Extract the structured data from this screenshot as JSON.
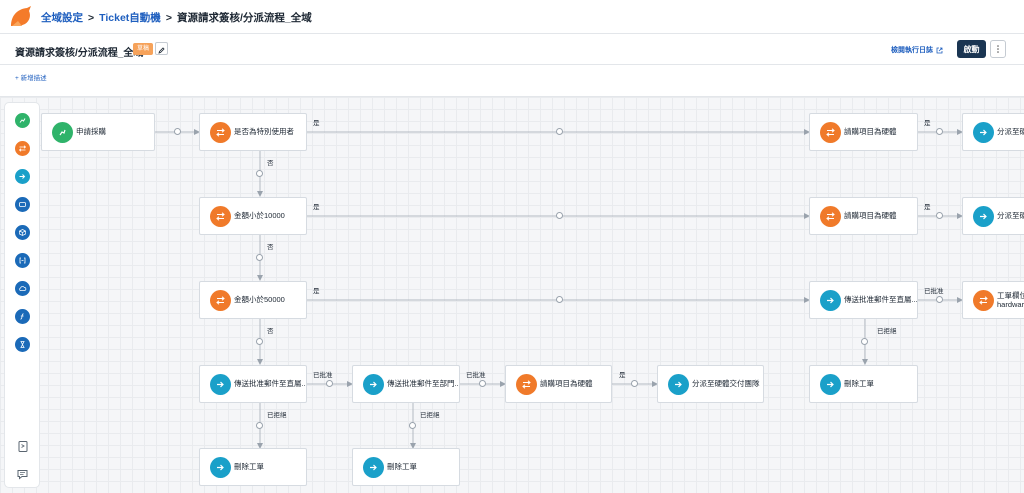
{
  "breadcrumb": {
    "items": [
      "全域設定",
      "Ticket自動機",
      "資源請求簽核/分派流程_全域"
    ],
    "separator": ">"
  },
  "header": {
    "title": "資源請求簽核/分派流程_全域",
    "status_badge": "草稿",
    "edit_icon": "pencil-icon",
    "log_link": "檢閱執行日誌",
    "log_icon": "external-link-icon",
    "start_button": "啟動",
    "more_icon": "vertical-dots-icon"
  },
  "add_description": "+ 新增描述",
  "colors": {
    "trigger": "#2fb36a",
    "condition": "#f07a2a",
    "action": "#1aa0c9",
    "toolblue": "#1b6ab8",
    "link": "#1f5fbf",
    "primary": "#1a3552"
  },
  "toolbox": {
    "items": [
      {
        "icon": "trigger-icon",
        "color": "#2fb36a"
      },
      {
        "icon": "condition-icon",
        "color": "#f07a2a"
      },
      {
        "icon": "action-arrow-icon",
        "color": "#1aa0c9"
      },
      {
        "icon": "ticket-icon",
        "color": "#1b6ab8"
      },
      {
        "icon": "cube-icon",
        "color": "#1b6ab8"
      },
      {
        "icon": "bracket-icon",
        "color": "#1b6ab8"
      },
      {
        "icon": "cloud-icon",
        "color": "#1b6ab8"
      },
      {
        "icon": "function-icon",
        "color": "#1b6ab8"
      },
      {
        "icon": "hourglass-icon",
        "color": "#1b6ab8"
      }
    ],
    "bottom": [
      "book-icon",
      "chat-icon"
    ]
  },
  "nodes": {
    "n_trigger": {
      "label": "申請採購",
      "type": "trigger"
    },
    "n_cond_special": {
      "label": "是否為特別使用者",
      "type": "condition"
    },
    "n_cond_hw1": {
      "label": "請購項目為硬體",
      "type": "condition"
    },
    "n_assign_hw1": {
      "label": "分派至硬體",
      "type": "action"
    },
    "n_cond_10000": {
      "label": "金額小於10000",
      "type": "condition"
    },
    "n_cond_hw2": {
      "label": "請購項目為硬體",
      "type": "condition"
    },
    "n_assign_hw2": {
      "label": "分派至硬體",
      "type": "action"
    },
    "n_cond_50000": {
      "label": "金額小於50000",
      "type": "condition"
    },
    "n_send_mgr1": {
      "label": "傳送批准郵件至直屬...",
      "type": "action"
    },
    "n_field_hw": {
      "label": "工單欄位,是 hardware",
      "line1": "工單欄位,是",
      "line2": "hardware",
      "type": "condition"
    },
    "n_send_mgr2": {
      "label": "傳送批准郵件至直屬...",
      "type": "action"
    },
    "n_send_dept": {
      "label": "傳送批准郵件至部門...",
      "type": "action"
    },
    "n_cond_hw3": {
      "label": "請購項目為硬體",
      "type": "condition"
    },
    "n_assign_team": {
      "label": "分派至硬體交付團隊",
      "type": "action"
    },
    "n_delete1": {
      "label": "刪除工單",
      "type": "action"
    },
    "n_delete2": {
      "label": "刪除工單",
      "type": "action"
    },
    "n_delete3": {
      "label": "刪除工單",
      "type": "action"
    }
  },
  "edge_labels": {
    "yes": "是",
    "no": "否",
    "approved": "已批准",
    "rejected": "已拒絕"
  }
}
